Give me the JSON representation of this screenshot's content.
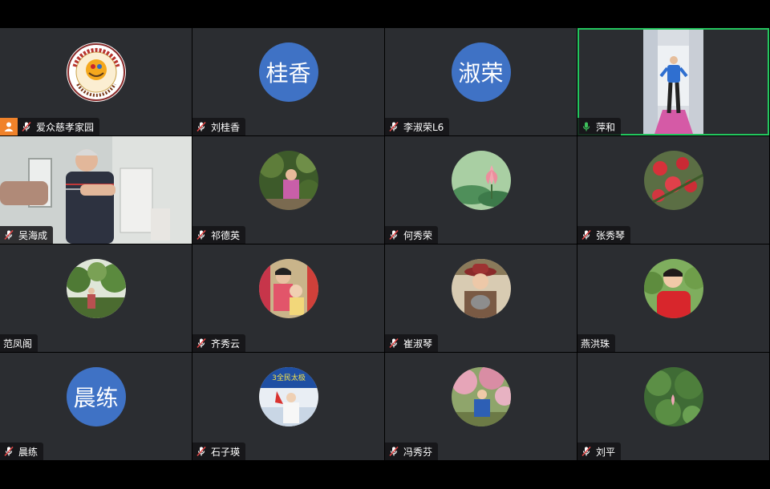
{
  "participants": [
    {
      "name": "爱众慈孝家园",
      "avatar_type": "logo",
      "mic": "muted",
      "host": true,
      "logo": {
        "ring_top": "爱为善 分享馨 德修身",
        "ring_bottom": "爱众慈孝家园",
        "sub": "ZCI TANGE"
      }
    },
    {
      "name": "刘桂香",
      "avatar_type": "text",
      "avatar_text": "桂香",
      "mic": "muted"
    },
    {
      "name": "李淑荣L6",
      "avatar_type": "text",
      "avatar_text": "淑荣",
      "mic": "muted"
    },
    {
      "name": "萍和",
      "avatar_type": "video_portrait",
      "mic": "on",
      "active": true
    },
    {
      "name": "吴海成",
      "avatar_type": "video_full",
      "mic": "muted"
    },
    {
      "name": "祁德英",
      "avatar_type": "photo",
      "mic": "muted",
      "photo": "garden-woman"
    },
    {
      "name": "何秀荣",
      "avatar_type": "photo",
      "mic": "muted",
      "photo": "lotus-painting"
    },
    {
      "name": "张秀琴",
      "avatar_type": "photo",
      "mic": "muted",
      "photo": "red-flowers"
    },
    {
      "name": "范凤阁",
      "avatar_type": "photo",
      "mic": "none",
      "photo": "park-trees"
    },
    {
      "name": "齐秀云",
      "avatar_type": "photo",
      "mic": "muted",
      "photo": "two-people"
    },
    {
      "name": "崔淑琴",
      "avatar_type": "photo",
      "mic": "muted",
      "photo": "woman-hat-cat"
    },
    {
      "name": "燕洪珠",
      "avatar_type": "photo",
      "mic": "none",
      "photo": "woman-red"
    },
    {
      "name": "晨练",
      "avatar_type": "text",
      "avatar_text": "晨练",
      "mic": "muted"
    },
    {
      "name": "石子瑛",
      "avatar_type": "photo",
      "mic": "muted",
      "photo": "stage-banner",
      "banner_text": "3全民太极"
    },
    {
      "name": "冯秀芬",
      "avatar_type": "photo",
      "mic": "muted",
      "photo": "blossom-tree"
    },
    {
      "name": "刘平",
      "avatar_type": "photo",
      "mic": "muted",
      "photo": "lotus-pond"
    }
  ],
  "colors": {
    "tile_bg": "#2b2d31",
    "active_border": "#23c55e",
    "avatar_blue": "#3f72c5",
    "host_orange": "#f0822a",
    "mic_muted": "#e04646",
    "mic_on": "#3ec25c"
  },
  "icons": {
    "mic_muted": "mic-muted-icon",
    "mic_on": "mic-icon",
    "host": "host-person-icon"
  }
}
